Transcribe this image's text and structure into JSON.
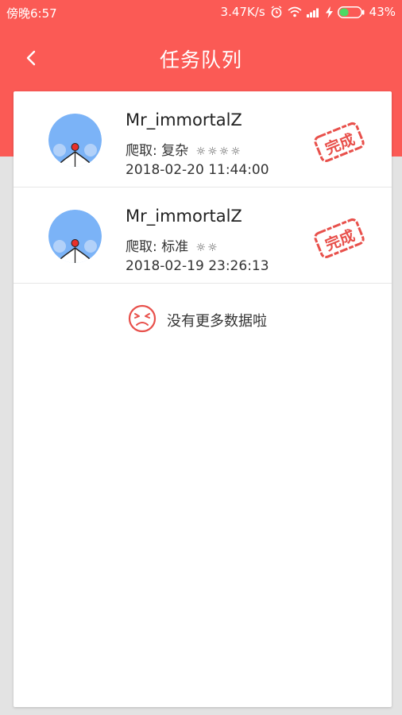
{
  "status_bar": {
    "time": "傍晚6:57",
    "speed": "3.47K/s",
    "battery": "43%",
    "battery_level": 0.43,
    "icons": [
      "alarm-icon",
      "wifi-icon",
      "signal-icon",
      "charging-icon",
      "battery-icon"
    ]
  },
  "header": {
    "title": "任务队列",
    "back_icon": "chevron-left-icon"
  },
  "colors": {
    "header_red": "#fb5a55",
    "stamp_red": "#e8504b",
    "avatar_blue": "#7bb3f7"
  },
  "tasks": [
    {
      "user": "Mr_immortalZ",
      "crawl_label": "爬取: 复杂",
      "stars": "☼☼☼☼",
      "timestamp": "2018-02-20 11:44:00",
      "status": "完成"
    },
    {
      "user": "Mr_immortalZ",
      "crawl_label": "爬取: 标准",
      "stars": "☼☼",
      "timestamp": "2018-02-19 23:26:13",
      "status": "完成"
    }
  ],
  "footer": {
    "no_more": "没有更多数据啦",
    "icon": "sad-face-icon"
  }
}
